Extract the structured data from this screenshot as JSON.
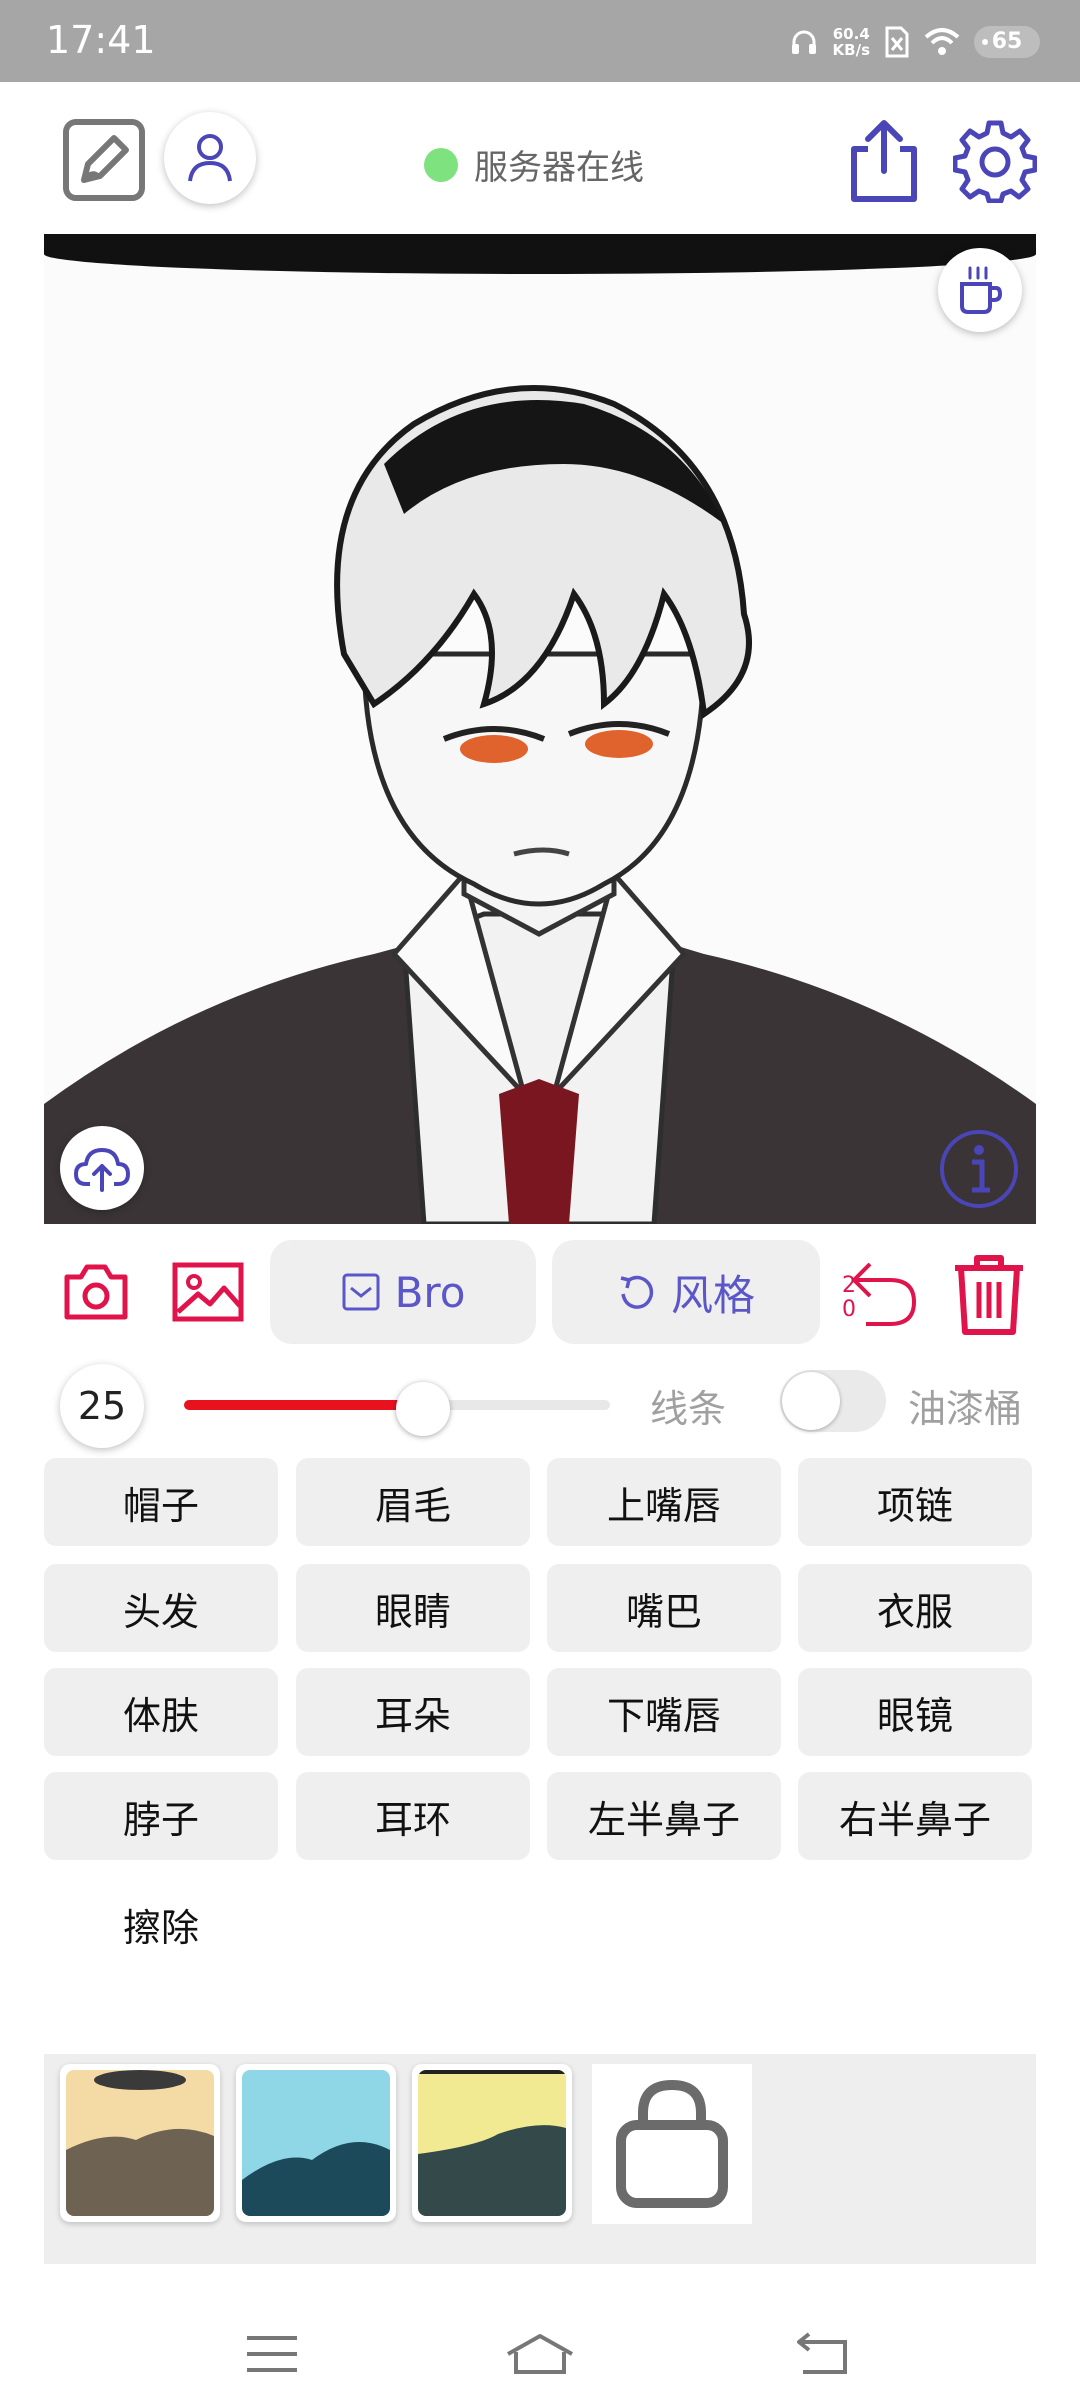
{
  "status_bar": {
    "time": "17:41",
    "net_speed_value": "60.4",
    "net_speed_unit": "KB/s",
    "battery": "65",
    "icons": [
      "headphones-icon",
      "sim-off-icon",
      "wifi-icon",
      "battery-icon"
    ]
  },
  "header": {
    "server_status": "服务器在线",
    "server_status_color": "#7ee27e",
    "icons": [
      "edit-icon",
      "user-icon",
      "share-icon",
      "gear-icon"
    ]
  },
  "canvas": {
    "content": "anime portrait sketch",
    "icons": [
      "coffee-cup-icon",
      "cloud-upload-icon",
      "info-icon"
    ]
  },
  "toolbar": {
    "brush_label": "Bro",
    "style_label": "风格",
    "undo_count_line1": "2",
    "undo_count_line2": "0",
    "accent_color": "#e0134a",
    "label_color": "#5b57c9"
  },
  "brush": {
    "size": "25",
    "size_fraction": 0.56,
    "lines_label": "线条",
    "bucket_label": "油漆桶",
    "bucket_enabled": false
  },
  "parts": [
    [
      "帽子",
      "眉毛",
      "上嘴唇",
      "项链"
    ],
    [
      "头发",
      "眼睛",
      "嘴巴",
      "衣服"
    ],
    [
      "体肤",
      "耳朵",
      "下嘴唇",
      "眼镜"
    ],
    [
      "脖子",
      "耳环",
      "左半鼻子",
      "右半鼻子"
    ]
  ],
  "erase_label": "擦除",
  "palette": {
    "swatches": [
      {
        "bg": "#f4dba5",
        "fg": "#6e6352"
      },
      {
        "bg": "#8fd6e6",
        "fg": "#1c4a5a"
      },
      {
        "bg": "#f2ea92",
        "fg": "#344a4a"
      }
    ],
    "lock_icon": "lock-icon"
  },
  "navbar": {
    "icons": [
      "menu-icon",
      "home-icon",
      "back-icon"
    ]
  }
}
